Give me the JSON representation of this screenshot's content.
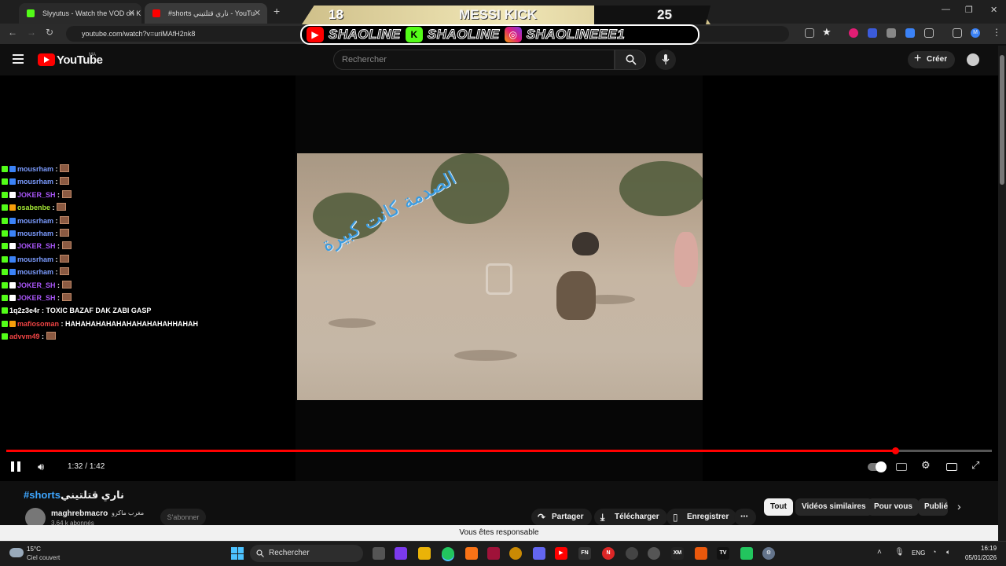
{
  "browser": {
    "tabs": [
      {
        "title": "Slyyutus - Watch the VOD on K",
        "icon_color": "#53fc18"
      },
      {
        "title": "#shorts ناري قتلتيني - YouTu",
        "icon_color": "#ff0000"
      }
    ],
    "new_tab": "+",
    "url": "youtube.com/watch?v=uriMAfH2nk8",
    "window_controls": [
      "—",
      "❐",
      "✕"
    ]
  },
  "overlay": {
    "score_left": "18",
    "event": "MESSI KICK",
    "score_right": "25",
    "socials": [
      {
        "platform": "youtube-icon",
        "handle": "SHAOLINE"
      },
      {
        "platform": "kick-icon",
        "handle": "SHAOLINE"
      },
      {
        "platform": "instagram-icon",
        "handle": "SHAOLINEEE1"
      }
    ]
  },
  "youtube": {
    "logo_text": "YouTube",
    "country": "MA",
    "search_placeholder": "Rechercher",
    "create_label": "Créer"
  },
  "video": {
    "overlay_text": "الصدمة كانت كبيرة"
  },
  "chat": [
    {
      "user": "mousrham",
      "color": "#7c9cff",
      "msg": "",
      "emote": true,
      "badge": "#3b82f6"
    },
    {
      "user": "mousrham",
      "color": "#7c9cff",
      "msg": "",
      "emote": true,
      "badge": "#3b82f6"
    },
    {
      "user": "JOKER_SH",
      "color": "#a855f7",
      "msg": "",
      "emote": true,
      "badge": "#fff"
    },
    {
      "user": "osabenbe",
      "color": "#a3e635",
      "msg": "",
      "emote": true,
      "badge": "#f59e0b"
    },
    {
      "user": "mousrham",
      "color": "#7c9cff",
      "msg": "",
      "emote": true,
      "badge": "#3b82f6"
    },
    {
      "user": "mousrham",
      "color": "#7c9cff",
      "msg": "",
      "emote": true,
      "badge": "#3b82f6"
    },
    {
      "user": "JOKER_SH",
      "color": "#a855f7",
      "msg": "",
      "emote": true,
      "badge": "#fff"
    },
    {
      "user": "mousrham",
      "color": "#7c9cff",
      "msg": "",
      "emote": true,
      "badge": "#3b82f6"
    },
    {
      "user": "mousrham",
      "color": "#7c9cff",
      "msg": "",
      "emote": true,
      "badge": "#3b82f6"
    },
    {
      "user": "JOKER_SH",
      "color": "#a855f7",
      "msg": "",
      "emote": true,
      "badge": "#fff"
    },
    {
      "user": "JOKER_SH",
      "color": "#a855f7",
      "msg": "",
      "emote": true,
      "badge": "#fff"
    },
    {
      "user": "1q2z3e4r",
      "color": "#ffffff",
      "msg": "TOXIC BAZAF DAK ZABI GASP",
      "emote": false,
      "badge": ""
    },
    {
      "user": "mafiosoman",
      "color": "#ef4444",
      "msg": "HAHAHAHAHAHAHAHAHAHAHHAHAH",
      "emote": false,
      "badge": "#f59e0b"
    },
    {
      "user": "advvm49",
      "color": "#ef4444",
      "msg": "",
      "emote": true,
      "badge": ""
    }
  ],
  "player": {
    "current_time": "1:32",
    "separator": "/",
    "duration": "1:42",
    "progress": 0.902
  },
  "below": {
    "title_tag": "#shorts",
    "title_ar": "ناري قتلتيني",
    "channel": "maghrebmacro",
    "channel_ar": "مغرب ماكرو",
    "subscribers": "3,64 k abonnés",
    "subscribe": "S'abonner",
    "actions": [
      {
        "icon": "share-icon",
        "glyph": "↷",
        "label": "Partager"
      },
      {
        "icon": "download-icon",
        "glyph": "⤓",
        "label": "Télécharger"
      },
      {
        "icon": "save-icon",
        "glyph": "▯",
        "label": "Enregistrer"
      }
    ],
    "chips": [
      "Tout",
      "Vidéos similaires",
      "Pour vous",
      "Publié"
    ],
    "notice": "Vous êtes responsable"
  },
  "taskbar": {
    "temp": "15°C",
    "weather": "Ciel couvert",
    "search": "Rechercher",
    "lang": "ENG",
    "time": "16:19",
    "date": "05/01/2026"
  }
}
